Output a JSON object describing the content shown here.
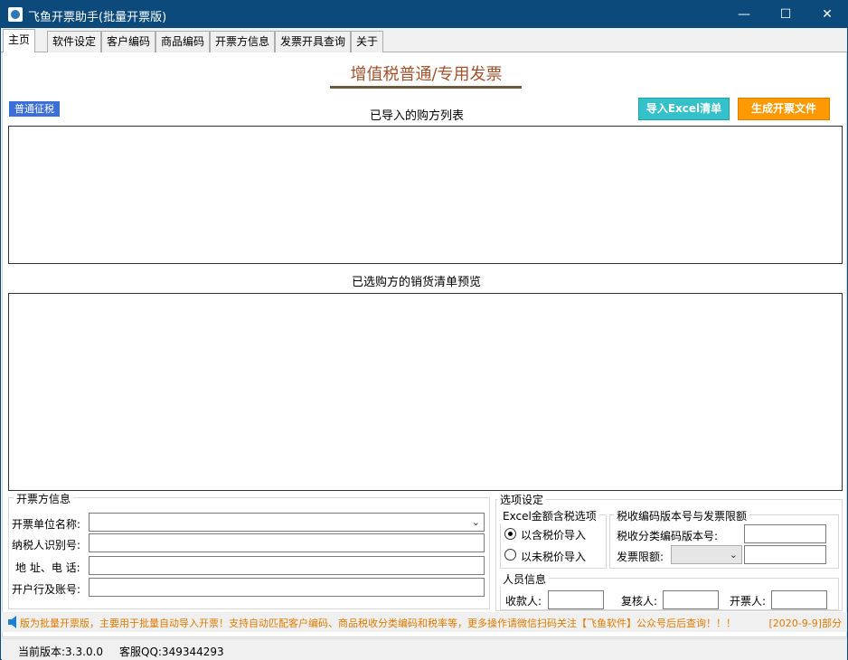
{
  "window": {
    "title": "飞鱼开票助手(批量开票版)"
  },
  "tabs": [
    "主页",
    "软件设定",
    "客户编码",
    "商品编码",
    "开票方信息",
    "发票开具查询",
    "关于"
  ],
  "main": {
    "heading": "增值税普通/专用发票",
    "badge": "普通征税",
    "import_button": "导入Excel清单",
    "generate_button": "生成开票文件",
    "buyers_label": "已导入的购方列表",
    "preview_label": "已选购方的销货清单预览"
  },
  "issuer": {
    "group_title": "开票方信息",
    "name_label": "开票单位名称:",
    "taxid_label": "纳税人识别号:",
    "address_label": "地 址、电 话:",
    "bank_label": "开户行及账号:"
  },
  "options": {
    "group_title": "选项设定",
    "excel_group": "Excel金额含税选项",
    "radio_tax_incl": "以含税价导入",
    "radio_tax_excl": "以未税价导入",
    "tax_group": "税收编码版本号与发票限额",
    "version_label": "税收分类编码版本号:",
    "limit_label": "发票限额:",
    "people_group": "人员信息",
    "payee_label": "收款人:",
    "reviewer_label": "复核人:",
    "drawer_label": "开票人:"
  },
  "notice": {
    "text": "版为批量开票版，主要用于批量自动导入开票！支持自动匹配客户编码、商品税收分类编码和税率等，更多操作请微信扫码关注【飞鱼软件】公众号后后查询！！！",
    "date": "[2020-9-9]部分"
  },
  "status": {
    "version": "当前版本:3.3.0.0",
    "qq": "客服QQ:349344293"
  },
  "icons": {
    "window_min": "minimize-icon",
    "window_max": "maximize-icon",
    "window_close": "close-icon",
    "speaker": "speaker-icon"
  },
  "colors": {
    "titlebar": "#0b4a7a",
    "accent_cyan": "#35c1c9",
    "accent_orange": "#ff9900",
    "notice": "#e07a00"
  }
}
